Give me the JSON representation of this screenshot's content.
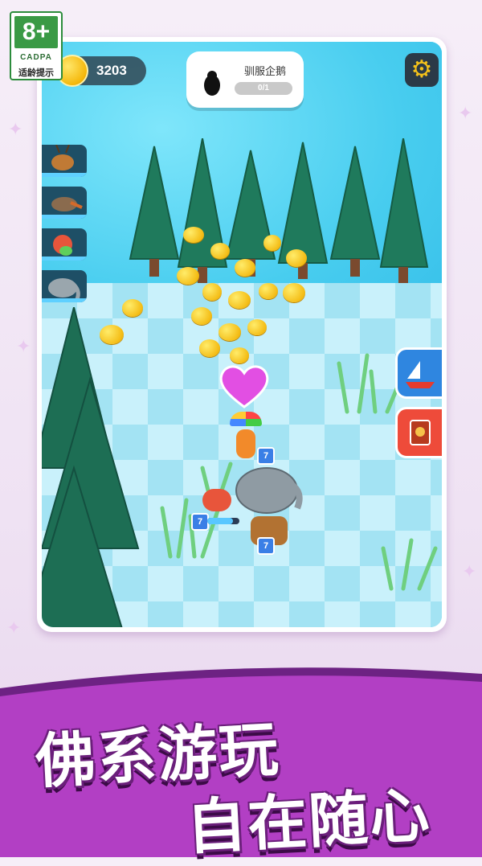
{
  "rating": {
    "age": "8+",
    "org": "CADPA",
    "tip": "适龄提示"
  },
  "hud": {
    "coins": "3203",
    "quest_title": "驯服企鹅",
    "quest_progress": "0/1",
    "settings_icon": "gear-icon"
  },
  "animals": [
    {
      "name": "deer-icon"
    },
    {
      "name": "duck-icon"
    },
    {
      "name": "parrot-icon"
    },
    {
      "name": "elephant-icon"
    }
  ],
  "side_buttons": [
    "boat-icon",
    "book-icon"
  ],
  "levels": [
    "7",
    "7",
    "7"
  ],
  "slogan": {
    "line1": "佛系游玩",
    "line2": "自在随心"
  },
  "colors": {
    "accent_purple": "#b23fc4",
    "water": "#48cdef",
    "tree": "#1f7a5c",
    "coin": "#f4bd16"
  }
}
